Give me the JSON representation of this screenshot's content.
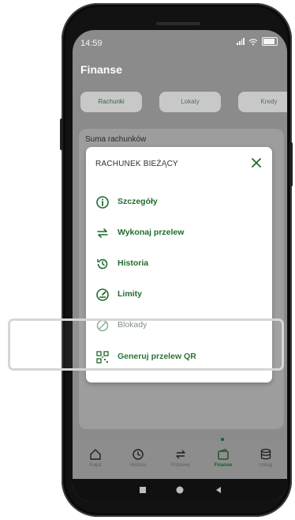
{
  "status_bar": {
    "time": "14:59"
  },
  "screen": {
    "title": "Finanse",
    "tabs": [
      {
        "label": "Rachunki",
        "active": true
      },
      {
        "label": "Lokaty",
        "active": false
      },
      {
        "label": "Kredy",
        "active": false
      }
    ],
    "summary_label": "Suma rachunków"
  },
  "modal": {
    "title": "RACHUNEK BIEŻĄCY",
    "close_icon": "close-icon",
    "items": [
      {
        "label": "Szczegóły",
        "icon": "info-icon"
      },
      {
        "label": "Wykonaj przelew",
        "icon": "transfer-icon"
      },
      {
        "label": "Historia",
        "icon": "history-icon"
      },
      {
        "label": "Limity",
        "icon": "gauge-icon"
      },
      {
        "label": "Blokady",
        "icon": "block-icon"
      },
      {
        "label": "Generuj przelew QR",
        "icon": "qr-icon"
      }
    ]
  },
  "bottom_nav": {
    "items": [
      {
        "label": "Pulpit",
        "icon": "home-icon"
      },
      {
        "label": "Historia",
        "icon": "history-icon"
      },
      {
        "label": "Przelewy",
        "icon": "transfer-icon"
      },
      {
        "label": "Finanse",
        "icon": "wallet-icon",
        "active": true
      },
      {
        "label": "Usługi",
        "icon": "database-icon"
      }
    ]
  },
  "colors": {
    "brand_green": "#1f6b2e",
    "overlay_gray": "#8b8b8b",
    "modal_bg": "#ffffff",
    "highlight_frame": "#d6d6d6"
  }
}
